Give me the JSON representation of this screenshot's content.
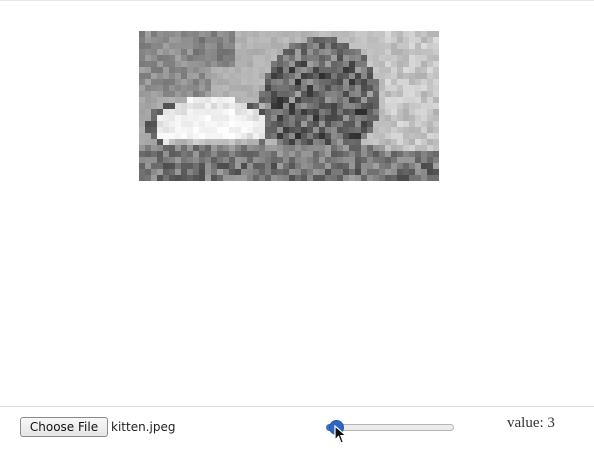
{
  "preview": {
    "subject": "pixelated grayscale kitten image"
  },
  "file_picker": {
    "button_label": "Choose File",
    "file_name": "kitten.jpeg"
  },
  "slider": {
    "min": 0,
    "max": 100,
    "value": 3,
    "fill_color": "#3b73c9",
    "thumb_color": "#2f67c2"
  },
  "value_display": {
    "prefix": "value:",
    "value": "3"
  }
}
